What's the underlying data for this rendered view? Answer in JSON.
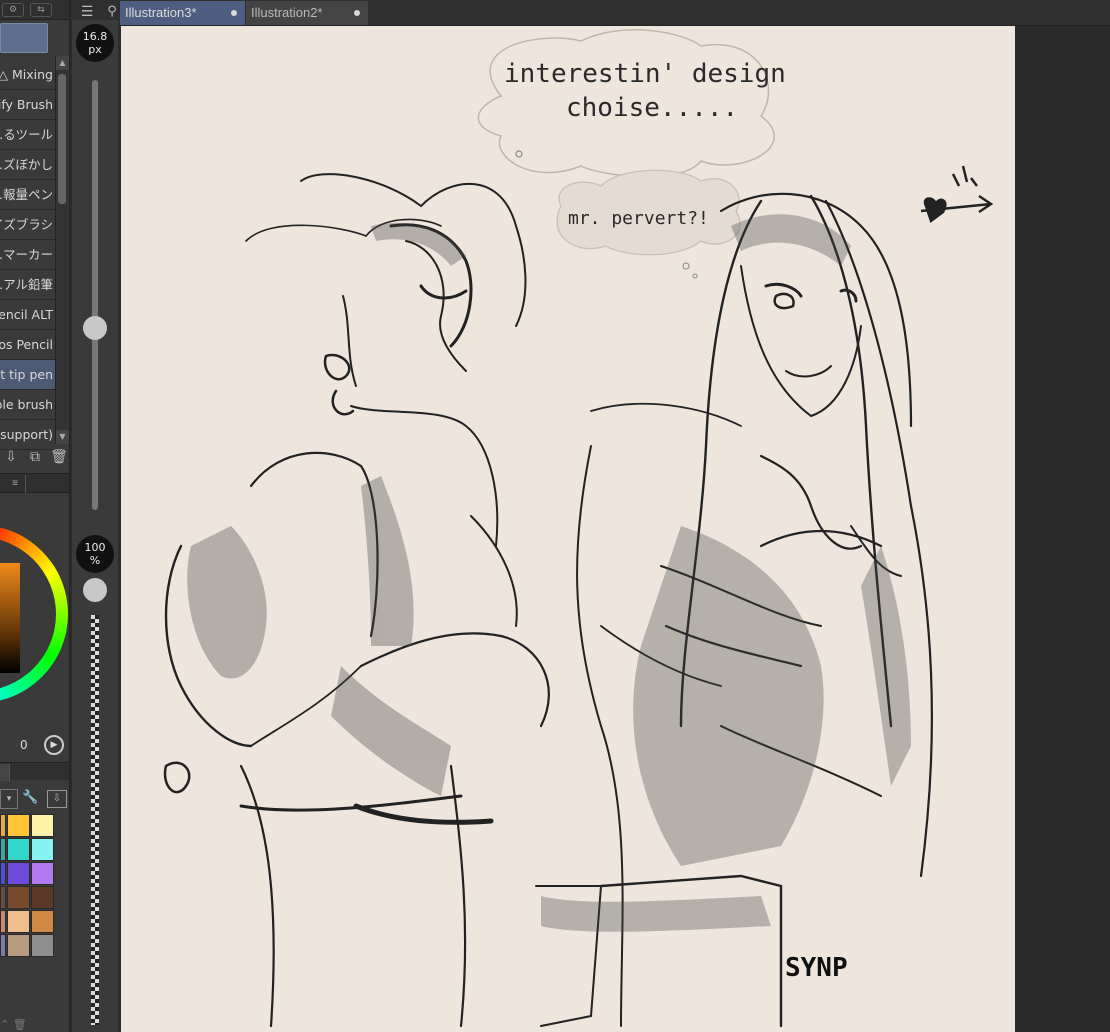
{
  "tabs": [
    {
      "label": "Illustration3*"
    },
    {
      "label": "Illustration2*"
    }
  ],
  "brush_size": {
    "value": "16.8",
    "unit": "px",
    "level": 0.4
  },
  "opacity": {
    "value": "100",
    "unit": "%",
    "level": 1.0
  },
  "brushes": [
    {
      "label": "…△ Mixing"
    },
    {
      "label": "…ify Brush"
    },
    {
      "label": "…るツール"
    },
    {
      "label": "…ズぼかし"
    },
    {
      "label": "…報量ペン"
    },
    {
      "label": "…イズブラシ"
    },
    {
      "label": "…マーカー"
    },
    {
      "label": "…アル鉛筆"
    },
    {
      "label": "…encil ALT"
    },
    {
      "label": "…os Pencil"
    },
    {
      "label": "…lt tip pen"
    },
    {
      "label": "…ble brush"
    },
    {
      "label": "…(support)"
    }
  ],
  "active_brush_index": 10,
  "color_readout": {
    "value": "0"
  },
  "palette": [
    "#e8a83c",
    "#ffc437",
    "#fff1a8",
    "#3aa6a0",
    "#33d7c9",
    "#86f3f5",
    "#4b4fd6",
    "#6d4ad9",
    "#b27af0",
    "#6b4a3f",
    "#7a4a2e",
    "#5a3a26",
    "#c98a6a",
    "#efbf8e",
    "#d08a45",
    "#7c7aa9",
    "#b79a80",
    "#8e8e8e"
  ],
  "artwork": {
    "speech_1_line1": "interestin' design",
    "speech_1_line2": "choise.....",
    "speech_2": "mr. pervert?!",
    "signature": "SYNP"
  }
}
